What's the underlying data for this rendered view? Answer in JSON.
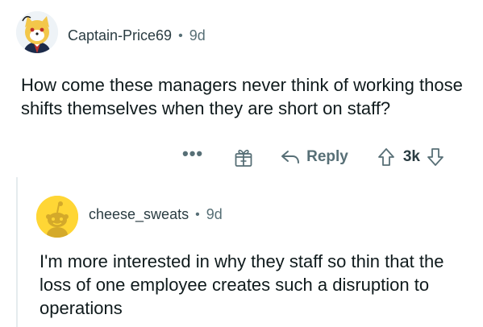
{
  "comments": [
    {
      "username": "Captain-Price69",
      "age": "9d",
      "body": "How come these managers never think of working those shifts themselves when they are short on staff?",
      "actions": {
        "more": "•••",
        "reply_label": "Reply",
        "vote_count": "3k"
      }
    },
    {
      "username": "cheese_sweats",
      "age": "9d",
      "body": "I'm more interested in why they staff so thin that the loss of one employee creates such a disruption to operations"
    }
  ],
  "separator": "•",
  "colors": {
    "meta": "#576f76",
    "text": "#0f1a1c",
    "avatar2_bg": "#ffd635"
  }
}
